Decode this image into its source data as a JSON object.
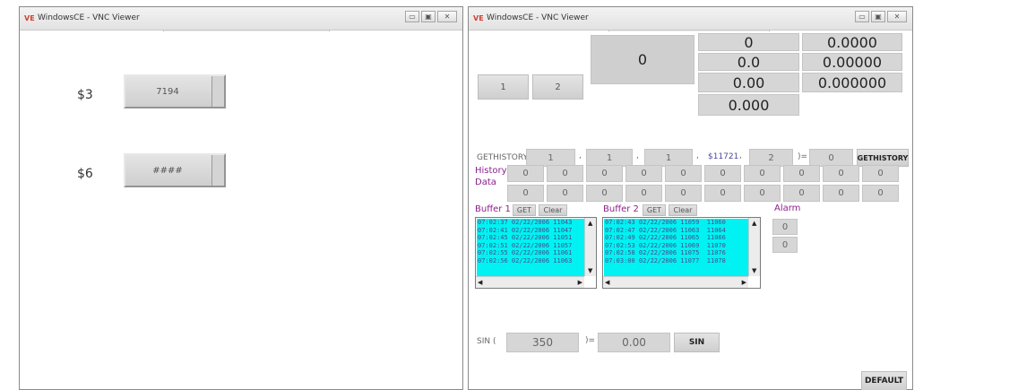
{
  "left_window": {
    "title": "WindowsCE - VNC Viewer",
    "app_icon": "VE",
    "label1": "$3",
    "value1": "7194",
    "label2": "$6",
    "value2": "####"
  },
  "right_window": {
    "title": "WindowsCE - VNC Viewer",
    "app_icon": "VE",
    "btn1": "1",
    "btn2": "2",
    "big_value": "0",
    "values_col1": [
      "0",
      "0.0",
      "0.00",
      "0.000"
    ],
    "values_col2": [
      "0.0000",
      "0.00000",
      "0.000000"
    ],
    "gethistory": {
      "label": "GETHISTORY(",
      "sep": ",",
      "args": [
        "1",
        "1",
        "1"
      ],
      "var": "$11721",
      "arg4": "2",
      "equals": ")=",
      "result": "0",
      "button": "GETHISTORY"
    },
    "history_label": "History Data",
    "history_row1": [
      "0",
      "0",
      "0",
      "0",
      "0",
      "0",
      "0",
      "0",
      "0",
      "0"
    ],
    "history_row2": [
      "0",
      "0",
      "0",
      "0",
      "0",
      "0",
      "0",
      "0",
      "0",
      "0"
    ],
    "buffer1": {
      "label": "Buffer 1",
      "get": "GET",
      "clear": "Clear",
      "lines": [
        "07:02:37 02/22/2006 11043",
        "07:02:41 02/22/2006 11047",
        "07:02:45 02/22/2006 11051",
        "07:02:51 02/22/2006 11057",
        "07:02:55 02/22/2006 11061",
        "07:02:56 02/22/2006 11063"
      ]
    },
    "buffer2": {
      "label": "Buffer 2",
      "get": "GET",
      "clear": "Clear",
      "lines": [
        "07:02:43 02/22/2006 11059  11060",
        "07:02:47 02/22/2006 11063  11064",
        "07:02:49 02/22/2006 11065  11066",
        "07:02:53 02/22/2006 11069  11070",
        "07:02:58 02/22/2006 11075  11076",
        "07:03:00 02/22/2006 11077  11078"
      ]
    },
    "alarm": {
      "label": "Alarm",
      "values": [
        "0",
        "0"
      ]
    },
    "sin": {
      "label": "SIN (",
      "input": "350",
      "equals": ")=",
      "result": "0.00",
      "button": "SIN"
    },
    "default_button": "DEFAULT"
  },
  "window_buttons": {
    "minimize": "▭",
    "maximize": "▣",
    "close": "✕"
  }
}
